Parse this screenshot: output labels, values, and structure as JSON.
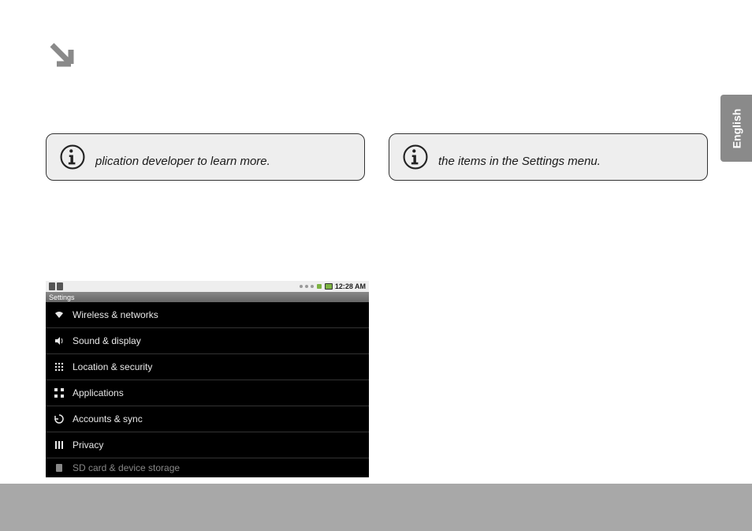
{
  "language_tab": "English",
  "notes": {
    "left_text": "plication developer to learn more.",
    "right_text": "the items in the Settings menu."
  },
  "screenshot": {
    "clock": "12:28 AM",
    "title": "Settings",
    "items": [
      {
        "label": "Wireless & networks"
      },
      {
        "label": "Sound & display"
      },
      {
        "label": "Location & security"
      },
      {
        "label": "Applications"
      },
      {
        "label": "Accounts & sync"
      },
      {
        "label": "Privacy"
      },
      {
        "label": "SD card & device storage"
      }
    ]
  }
}
